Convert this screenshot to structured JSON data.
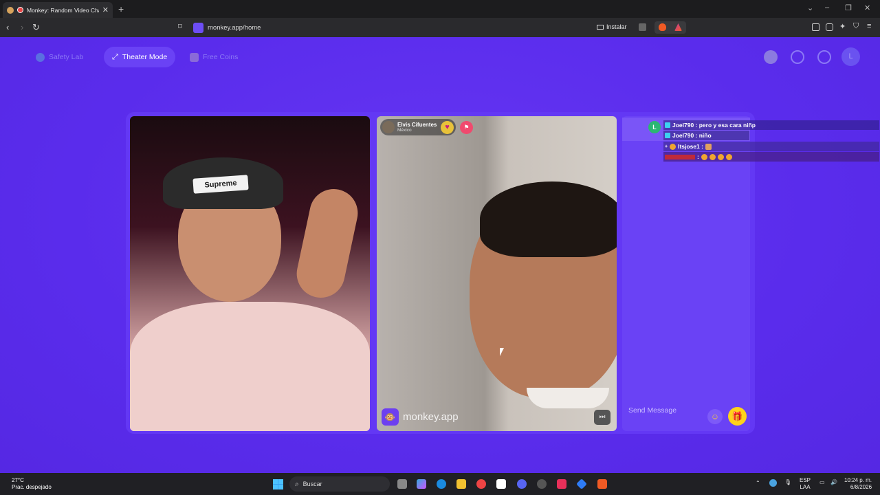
{
  "browser": {
    "tab_title": "Monkey: Random Video Chat",
    "url": "monkey.app/home",
    "install_label": "Instalar"
  },
  "topnav": {
    "safety_lab": "Safety Lab",
    "theater_mode": "Theater Mode",
    "free_coins": "Free Coins",
    "avatar_initial": "L"
  },
  "video": {
    "remote_name": "Elvis Cifuentes",
    "remote_country": "México",
    "cap_text": "Supreme",
    "watermark": "monkey.app"
  },
  "chat": {
    "avatar_initial": "L",
    "messages": [
      {
        "text": "Joel790 : pero y esa cara niñp"
      },
      {
        "text": "Joel790 : niño"
      },
      {
        "text": "Itsjose1 :"
      },
      {
        "text": ":"
      }
    ],
    "placeholder": "Send Message"
  },
  "taskbar": {
    "temperature": "27°C",
    "weather": "Prac. despejado",
    "search": "Buscar",
    "lang1": "ESP",
    "lang2": "LAA",
    "time": "10:24 p. m.",
    "date": "6/8/2026"
  },
  "colors": {
    "page_bg": "#5b2df0",
    "accent": "#6a42f5",
    "gift": "#ffd21c"
  }
}
